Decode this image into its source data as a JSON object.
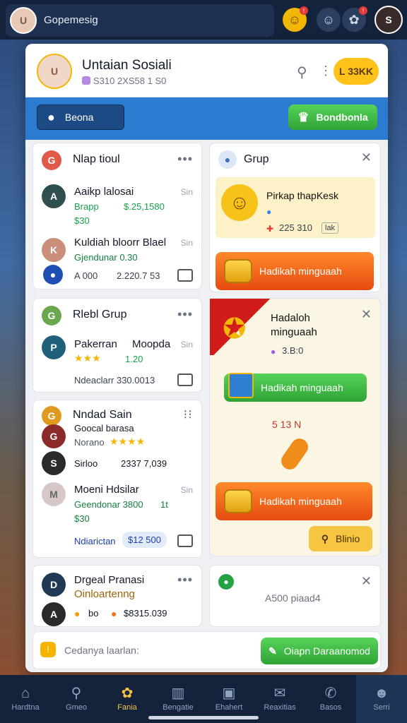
{
  "topbar": {
    "username": "Gopemesig"
  },
  "header": {
    "title": "Untaian Sosiali",
    "subtitle": "S310 2XS58 1 S0",
    "coin_label": "L 33KK"
  },
  "bluebar": {
    "profile_label": "Beona",
    "button_label": "Bondbonla"
  },
  "card1": {
    "title": "Nlap tioul",
    "items": [
      {
        "name": "Aaikp lalosai",
        "detail1": "Brapp",
        "detail2": "$.25,1580",
        "detail3": "$30",
        "time": "Sin"
      },
      {
        "name": "Kuldiah bloorr Blael",
        "detail1": "Gjendunar 0.30",
        "time": "Sin"
      }
    ],
    "footer_left": "A 000",
    "footer_right": "2.220.7 53"
  },
  "card2": {
    "title": "Rlebl Grup",
    "items": [
      {
        "name": "Pakerran",
        "name2": "Moopda",
        "detail": "1.20",
        "time": "Sin"
      }
    ],
    "footer": "Ndeaclarr 330.0013"
  },
  "card3": {
    "title": "Nndad Sain",
    "items": [
      {
        "name": "Goocal barasa",
        "detail": "Norano"
      },
      {
        "name": "Sirloo",
        "detail": "2337 7,039"
      },
      {
        "name": "Moeni Hdsilar",
        "detail1": "Geendonar 3800",
        "detail1b": "1t",
        "detail2": "$30",
        "time": "Sin"
      }
    ],
    "footer_left": "Ndiarictan",
    "footer_right": "$12 500"
  },
  "card4": {
    "title": "Drgeal Pranasi",
    "subtitle": "Oinloartenng",
    "row_a": "bo",
    "row_b": "$8315.039"
  },
  "grup": {
    "title": "Grup",
    "promo_title": "Pirkap thapKesk",
    "promo_value": "225 310",
    "promo_tag": "lak",
    "btn1": "Hadikah minguaah"
  },
  "gift": {
    "title": "Hadaloh minguaah",
    "value": "3.B:0",
    "btn_green": "Hadikah minguaah",
    "math": "5 13 N",
    "btn_orange": "Hadikah minguaah",
    "small_btn": "Blinio"
  },
  "small_card": {
    "text": "A500 piaad4"
  },
  "bottom_bar": {
    "placeholder": "Cedanya laarlan:",
    "button": "Oiapn Daraanomod"
  },
  "nav": [
    {
      "label": "Hardtna",
      "icon": "home-icon"
    },
    {
      "label": "Gmeo",
      "icon": "search-icon"
    },
    {
      "label": "Fania",
      "icon": "chat-icon"
    },
    {
      "label": "Bengatie",
      "icon": "building-icon"
    },
    {
      "label": "Ehahert",
      "icon": "store-icon"
    },
    {
      "label": "Reaxitias",
      "icon": "bubble-icon"
    },
    {
      "label": "Basos",
      "icon": "message-icon"
    },
    {
      "label": "Serri",
      "icon": "profile-icon"
    }
  ],
  "colors": {
    "accent_blue": "#2b7bd1",
    "orange": "#f28c28",
    "green": "#3cb043"
  }
}
